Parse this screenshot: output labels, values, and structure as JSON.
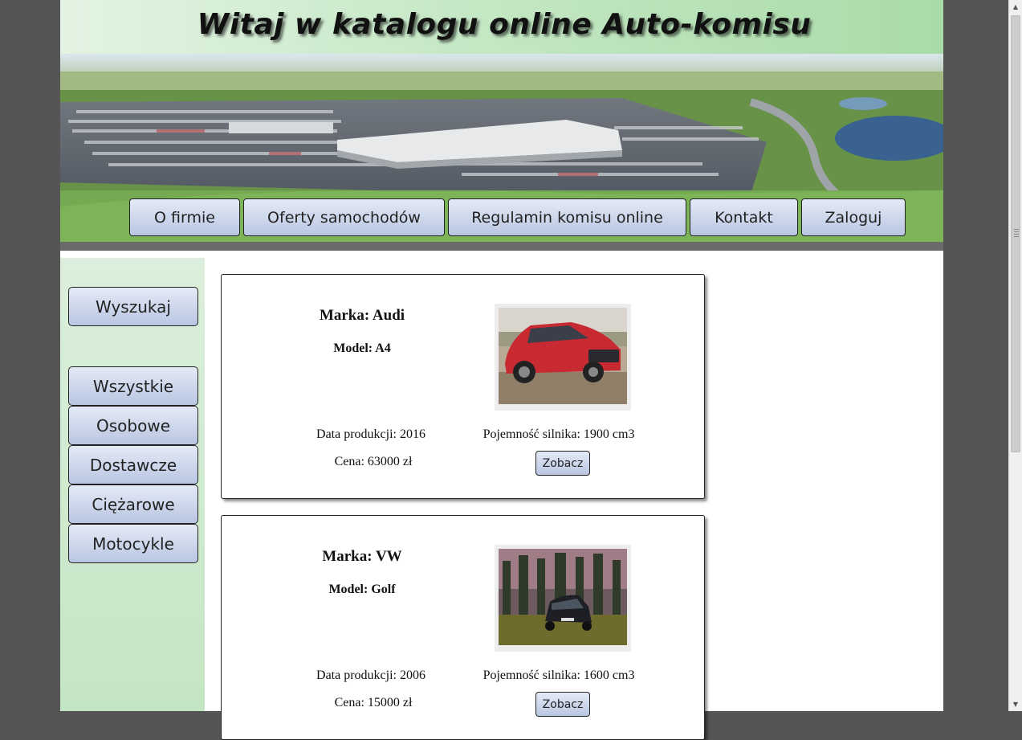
{
  "header": {
    "title": "Witaj w katalogu online Auto-komisu"
  },
  "nav": {
    "items": [
      {
        "label": "O firmie"
      },
      {
        "label": "Oferty samochodów"
      },
      {
        "label": "Regulamin komisu online"
      },
      {
        "label": "Kontakt"
      },
      {
        "label": "Zaloguj"
      }
    ]
  },
  "sidebar": {
    "search_label": "Wyszukaj",
    "categories": [
      {
        "label": "Wszystkie"
      },
      {
        "label": "Osobowe"
      },
      {
        "label": "Dostawcze"
      },
      {
        "label": "Ciężarowe"
      },
      {
        "label": "Motocykle"
      }
    ]
  },
  "cars": [
    {
      "brand": "Marka: Audi",
      "model": "Model: A4",
      "year": "Data produkcji: 2016",
      "engine": "Pojemność silnika: 1900 cm3",
      "price": "Cena: 63000 zł",
      "button": "Zobacz"
    },
    {
      "brand": "Marka: VW",
      "model": "Model: Golf",
      "year": "Data produkcji: 2006",
      "engine": "Pojemność silnika: 1600 cm3",
      "price": "Cena: 15000 zł",
      "button": "Zobacz"
    }
  ],
  "colors": {
    "page_background": "#555555",
    "header_gradient_start": "#e3f3e3",
    "header_gradient_end": "#a9dba9",
    "button_gradient_start": "#e4eaf6",
    "button_gradient_end": "#b9c6e2",
    "sidebar_background": "#c4e5c4"
  },
  "icons": {
    "scroll_up": "scroll-up-arrow-icon",
    "scroll_down": "scroll-down-arrow-icon"
  }
}
